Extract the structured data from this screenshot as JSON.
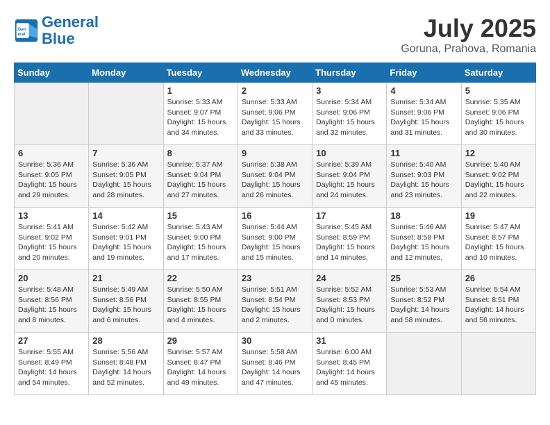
{
  "header": {
    "logo_line1": "General",
    "logo_line2": "Blue",
    "month": "July 2025",
    "location": "Goruna, Prahova, Romania"
  },
  "weekdays": [
    "Sunday",
    "Monday",
    "Tuesday",
    "Wednesday",
    "Thursday",
    "Friday",
    "Saturday"
  ],
  "weeks": [
    [
      {
        "day": "",
        "info": ""
      },
      {
        "day": "",
        "info": ""
      },
      {
        "day": "1",
        "info": "Sunrise: 5:33 AM\nSunset: 9:07 PM\nDaylight: 15 hours and 34 minutes."
      },
      {
        "day": "2",
        "info": "Sunrise: 5:33 AM\nSunset: 9:06 PM\nDaylight: 15 hours and 33 minutes."
      },
      {
        "day": "3",
        "info": "Sunrise: 5:34 AM\nSunset: 9:06 PM\nDaylight: 15 hours and 32 minutes."
      },
      {
        "day": "4",
        "info": "Sunrise: 5:34 AM\nSunset: 9:06 PM\nDaylight: 15 hours and 31 minutes."
      },
      {
        "day": "5",
        "info": "Sunrise: 5:35 AM\nSunset: 9:06 PM\nDaylight: 15 hours and 30 minutes."
      }
    ],
    [
      {
        "day": "6",
        "info": "Sunrise: 5:36 AM\nSunset: 9:05 PM\nDaylight: 15 hours and 29 minutes."
      },
      {
        "day": "7",
        "info": "Sunrise: 5:36 AM\nSunset: 9:05 PM\nDaylight: 15 hours and 28 minutes."
      },
      {
        "day": "8",
        "info": "Sunrise: 5:37 AM\nSunset: 9:04 PM\nDaylight: 15 hours and 27 minutes."
      },
      {
        "day": "9",
        "info": "Sunrise: 5:38 AM\nSunset: 9:04 PM\nDaylight: 15 hours and 26 minutes."
      },
      {
        "day": "10",
        "info": "Sunrise: 5:39 AM\nSunset: 9:04 PM\nDaylight: 15 hours and 24 minutes."
      },
      {
        "day": "11",
        "info": "Sunrise: 5:40 AM\nSunset: 9:03 PM\nDaylight: 15 hours and 23 minutes."
      },
      {
        "day": "12",
        "info": "Sunrise: 5:40 AM\nSunset: 9:02 PM\nDaylight: 15 hours and 22 minutes."
      }
    ],
    [
      {
        "day": "13",
        "info": "Sunrise: 5:41 AM\nSunset: 9:02 PM\nDaylight: 15 hours and 20 minutes."
      },
      {
        "day": "14",
        "info": "Sunrise: 5:42 AM\nSunset: 9:01 PM\nDaylight: 15 hours and 19 minutes."
      },
      {
        "day": "15",
        "info": "Sunrise: 5:43 AM\nSunset: 9:00 PM\nDaylight: 15 hours and 17 minutes."
      },
      {
        "day": "16",
        "info": "Sunrise: 5:44 AM\nSunset: 9:00 PM\nDaylight: 15 hours and 15 minutes."
      },
      {
        "day": "17",
        "info": "Sunrise: 5:45 AM\nSunset: 8:59 PM\nDaylight: 15 hours and 14 minutes."
      },
      {
        "day": "18",
        "info": "Sunrise: 5:46 AM\nSunset: 8:58 PM\nDaylight: 15 hours and 12 minutes."
      },
      {
        "day": "19",
        "info": "Sunrise: 5:47 AM\nSunset: 8:57 PM\nDaylight: 15 hours and 10 minutes."
      }
    ],
    [
      {
        "day": "20",
        "info": "Sunrise: 5:48 AM\nSunset: 8:56 PM\nDaylight: 15 hours and 8 minutes."
      },
      {
        "day": "21",
        "info": "Sunrise: 5:49 AM\nSunset: 8:56 PM\nDaylight: 15 hours and 6 minutes."
      },
      {
        "day": "22",
        "info": "Sunrise: 5:50 AM\nSunset: 8:55 PM\nDaylight: 15 hours and 4 minutes."
      },
      {
        "day": "23",
        "info": "Sunrise: 5:51 AM\nSunset: 8:54 PM\nDaylight: 15 hours and 2 minutes."
      },
      {
        "day": "24",
        "info": "Sunrise: 5:52 AM\nSunset: 8:53 PM\nDaylight: 15 hours and 0 minutes."
      },
      {
        "day": "25",
        "info": "Sunrise: 5:53 AM\nSunset: 8:52 PM\nDaylight: 14 hours and 58 minutes."
      },
      {
        "day": "26",
        "info": "Sunrise: 5:54 AM\nSunset: 8:51 PM\nDaylight: 14 hours and 56 minutes."
      }
    ],
    [
      {
        "day": "27",
        "info": "Sunrise: 5:55 AM\nSunset: 8:49 PM\nDaylight: 14 hours and 54 minutes."
      },
      {
        "day": "28",
        "info": "Sunrise: 5:56 AM\nSunset: 8:48 PM\nDaylight: 14 hours and 52 minutes."
      },
      {
        "day": "29",
        "info": "Sunrise: 5:57 AM\nSunset: 8:47 PM\nDaylight: 14 hours and 49 minutes."
      },
      {
        "day": "30",
        "info": "Sunrise: 5:58 AM\nSunset: 8:46 PM\nDaylight: 14 hours and 47 minutes."
      },
      {
        "day": "31",
        "info": "Sunrise: 6:00 AM\nSunset: 8:45 PM\nDaylight: 14 hours and 45 minutes."
      },
      {
        "day": "",
        "info": ""
      },
      {
        "day": "",
        "info": ""
      }
    ]
  ]
}
